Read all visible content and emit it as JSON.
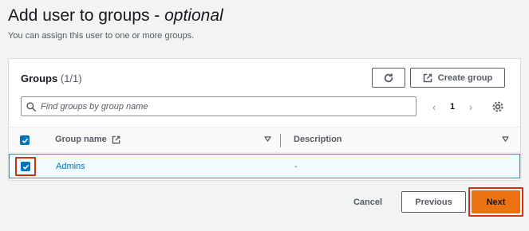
{
  "page": {
    "title_main": "Add user to groups - ",
    "title_optional": "optional",
    "subtitle": "You can assign this user to one or more groups."
  },
  "panel": {
    "title": "Groups",
    "count": "(1/1)",
    "refresh_icon": "refresh-icon",
    "create_group_label": "Create group",
    "create_group_icon": "external-link-icon",
    "search": {
      "placeholder": "Find groups by group name",
      "value": "",
      "icon": "search-icon"
    },
    "pagination": {
      "current_page": "1",
      "prev_icon": "chevron-left-icon",
      "next_icon": "chevron-right-icon"
    },
    "settings_icon": "gear-icon"
  },
  "table": {
    "columns": [
      {
        "label": "Group name",
        "icon": "external-link-icon",
        "sort_icon": "caret-down-icon"
      },
      {
        "label": "Description",
        "sort_icon": "caret-down-icon"
      }
    ],
    "select_all_checked": true,
    "rows": [
      {
        "name": "Admins",
        "description": "-",
        "checked": true
      }
    ]
  },
  "footer": {
    "cancel_label": "Cancel",
    "previous_label": "Previous",
    "next_label": "Next"
  },
  "colors": {
    "accent_blue": "#0073bb",
    "primary_orange": "#ec7211",
    "highlight_red": "#d13212",
    "selected_row_bg": "#f1faff"
  }
}
